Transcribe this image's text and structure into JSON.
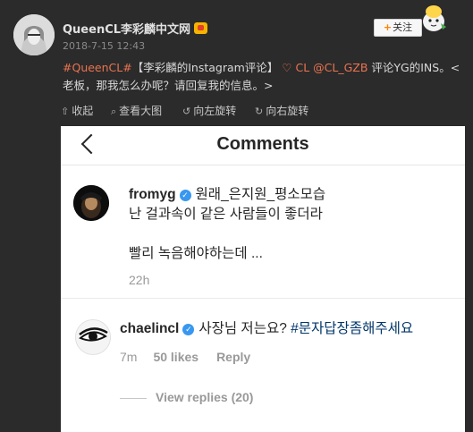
{
  "post": {
    "username": "QueenCL李彩麟中文网",
    "timestamp": "2018-7-15 12:43",
    "follow_plus": "+",
    "follow_label": "关注",
    "hashtag": "#QueenCL#",
    "text_part1": "【李彩麟的Instagram评论】",
    "heart": "♡",
    "mention": "CL @CL_GZB",
    "text_part2": "评论YG的INS。<老板，那我怎么办呢？请回复我的信息。>"
  },
  "toolbar": {
    "collapse": "收起",
    "view_large": "查看大图",
    "rotate_left": "向左旋转",
    "rotate_right": "向右旋转"
  },
  "instagram": {
    "title": "Comments",
    "comments": [
      {
        "handle": "fromyg",
        "line1": "원래_은지원_평소모습",
        "line2": "난 걸과속이 같은 사람들이 좋더라",
        "line3": "빨리 녹음해야하는데 ...",
        "time": "22h"
      },
      {
        "handle": "chaelincl",
        "text": "사장님 저는요?",
        "tag": "#문자답장좀해주세요",
        "time": "7m",
        "likes": "50 likes",
        "reply": "Reply"
      }
    ],
    "view_replies": "View replies (20)"
  },
  "colors": {
    "accent": "#eb7350",
    "verified": "#3897f0",
    "background": "#2b2b2b"
  }
}
